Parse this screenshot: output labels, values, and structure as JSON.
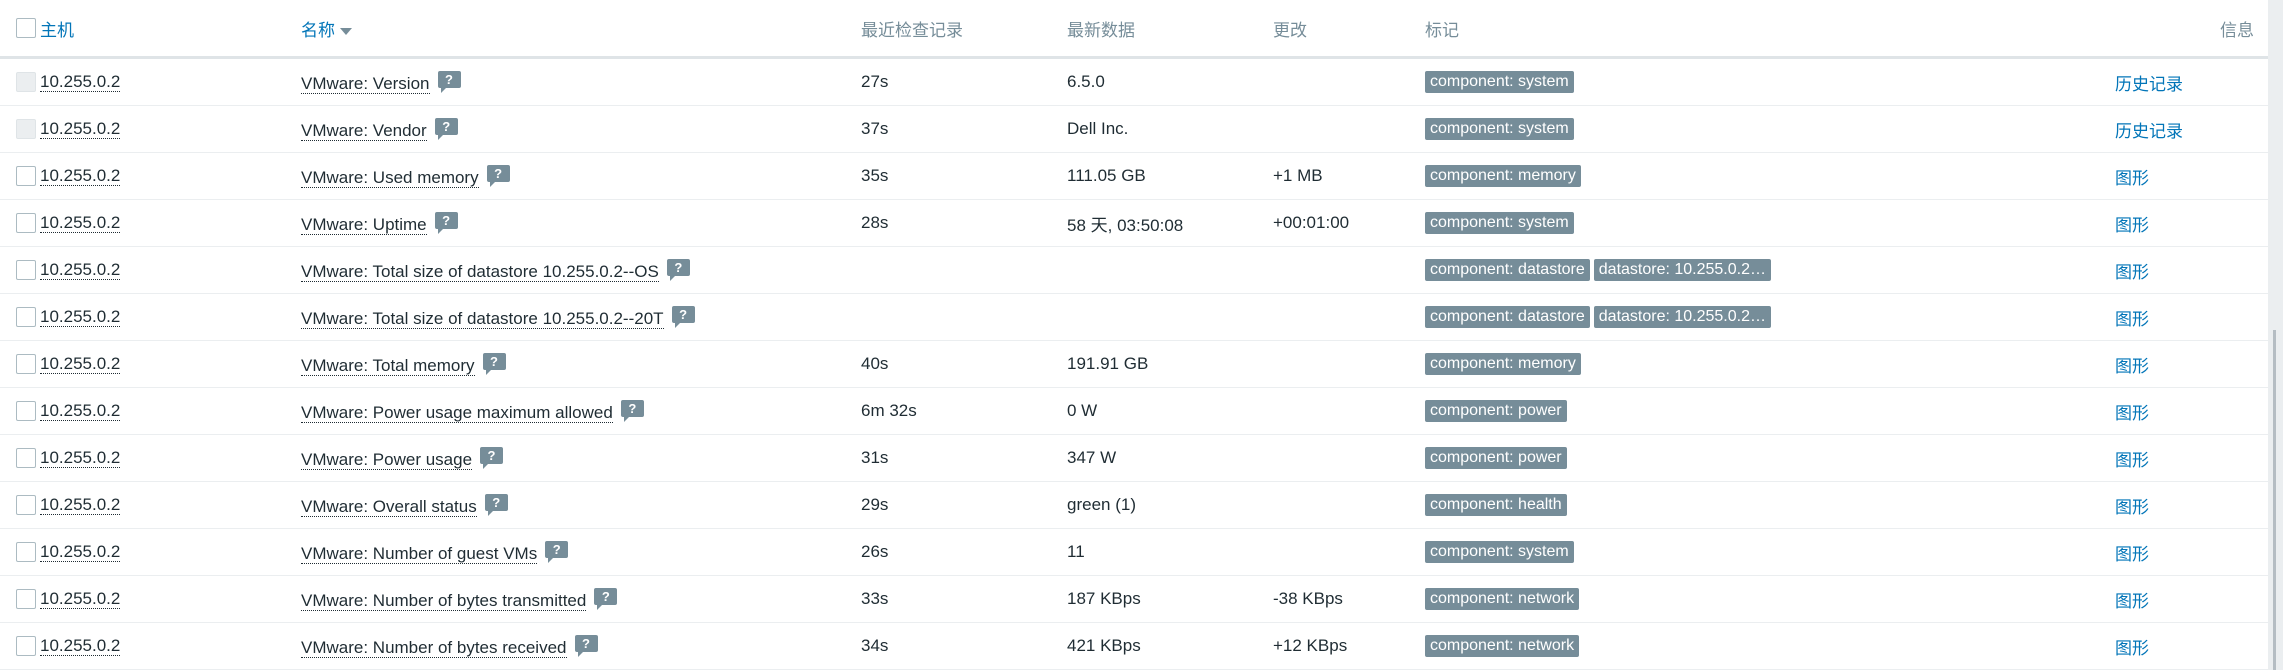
{
  "header": {
    "host": "主机",
    "name": "名称",
    "last_check": "最近检查记录",
    "last_value": "最新数据",
    "change": "更改",
    "tags": "标记",
    "info": "信息"
  },
  "hint_glyph": "?",
  "colors": {
    "link": "#0275b8",
    "tag_bg": "#768d99",
    "header_text": "#768d99"
  },
  "rows": [
    {
      "host": "10.255.0.2",
      "name": "VMware: Version",
      "last_check": "27s",
      "last_value": "6.5.0",
      "change": "",
      "tags": [
        "component: system"
      ],
      "action": "历史记录",
      "checkbox_disabled": true
    },
    {
      "host": "10.255.0.2",
      "name": "VMware: Vendor",
      "last_check": "37s",
      "last_value": "Dell Inc.",
      "change": "",
      "tags": [
        "component: system"
      ],
      "action": "历史记录",
      "checkbox_disabled": true
    },
    {
      "host": "10.255.0.2",
      "name": "VMware: Used memory",
      "last_check": "35s",
      "last_value": "111.05 GB",
      "change": "+1 MB",
      "tags": [
        "component: memory"
      ],
      "action": "图形",
      "checkbox_disabled": false
    },
    {
      "host": "10.255.0.2",
      "name": "VMware: Uptime",
      "last_check": "28s",
      "last_value": "58 天, 03:50:08",
      "change": "+00:01:00",
      "tags": [
        "component: system"
      ],
      "action": "图形",
      "checkbox_disabled": false
    },
    {
      "host": "10.255.0.2",
      "name": "VMware: Total size of datastore 10.255.0.2--OS",
      "last_check": "",
      "last_value": "",
      "change": "",
      "tags": [
        "component: datastore",
        "datastore: 10.255.0.2…"
      ],
      "action": "图形",
      "checkbox_disabled": false
    },
    {
      "host": "10.255.0.2",
      "name": "VMware: Total size of datastore 10.255.0.2--20T",
      "last_check": "",
      "last_value": "",
      "change": "",
      "tags": [
        "component: datastore",
        "datastore: 10.255.0.2…"
      ],
      "action": "图形",
      "checkbox_disabled": false
    },
    {
      "host": "10.255.0.2",
      "name": "VMware: Total memory",
      "last_check": "40s",
      "last_value": "191.91 GB",
      "change": "",
      "tags": [
        "component: memory"
      ],
      "action": "图形",
      "checkbox_disabled": false
    },
    {
      "host": "10.255.0.2",
      "name": "VMware: Power usage maximum allowed",
      "last_check": "6m 32s",
      "last_value": "0 W",
      "change": "",
      "tags": [
        "component: power"
      ],
      "action": "图形",
      "checkbox_disabled": false
    },
    {
      "host": "10.255.0.2",
      "name": "VMware: Power usage",
      "last_check": "31s",
      "last_value": "347 W",
      "change": "",
      "tags": [
        "component: power"
      ],
      "action": "图形",
      "checkbox_disabled": false
    },
    {
      "host": "10.255.0.2",
      "name": "VMware: Overall status",
      "last_check": "29s",
      "last_value": "green (1)",
      "change": "",
      "tags": [
        "component: health"
      ],
      "action": "图形",
      "checkbox_disabled": false
    },
    {
      "host": "10.255.0.2",
      "name": "VMware: Number of guest VMs",
      "last_check": "26s",
      "last_value": "11",
      "change": "",
      "tags": [
        "component: system"
      ],
      "action": "图形",
      "checkbox_disabled": false
    },
    {
      "host": "10.255.0.2",
      "name": "VMware: Number of bytes transmitted",
      "last_check": "33s",
      "last_value": "187 KBps",
      "change": "-38 KBps",
      "tags": [
        "component: network"
      ],
      "action": "图形",
      "checkbox_disabled": false
    },
    {
      "host": "10.255.0.2",
      "name": "VMware: Number of bytes received",
      "last_check": "34s",
      "last_value": "421 KBps",
      "change": "+12 KBps",
      "tags": [
        "component: network"
      ],
      "action": "图形",
      "checkbox_disabled": false
    }
  ]
}
